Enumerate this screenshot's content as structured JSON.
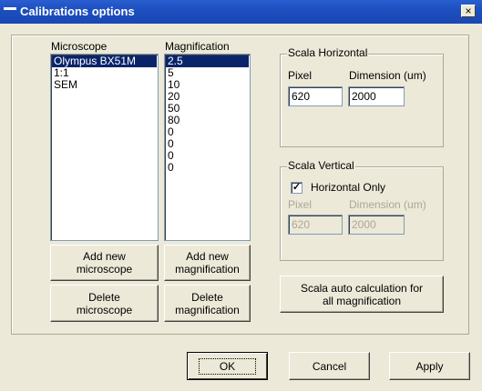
{
  "window": {
    "title": "Calibrations options",
    "close_glyph": "×"
  },
  "microscope": {
    "label": "Microscope",
    "items": [
      {
        "label": "Olympus BX51M",
        "selected": true
      },
      {
        "label": "1:1",
        "selected": false
      },
      {
        "label": "SEM",
        "selected": false
      }
    ],
    "add_button_line1": "Add new",
    "add_button_line2": "microscope",
    "delete_button_line1": "Delete",
    "delete_button_line2": "microscope"
  },
  "magnification": {
    "label": "Magnification",
    "items": [
      {
        "label": "2.5",
        "selected": true
      },
      {
        "label": "5",
        "selected": false
      },
      {
        "label": "10",
        "selected": false
      },
      {
        "label": "20",
        "selected": false
      },
      {
        "label": "50",
        "selected": false
      },
      {
        "label": "80",
        "selected": false
      },
      {
        "label": "0",
        "selected": false
      },
      {
        "label": "0",
        "selected": false
      },
      {
        "label": "0",
        "selected": false
      },
      {
        "label": "0",
        "selected": false
      }
    ],
    "add_button_line1": "Add new",
    "add_button_line2": "magnification",
    "delete_button_line1": "Delete",
    "delete_button_line2": "magnification"
  },
  "scala_horizontal": {
    "title": "Scala Horizontal",
    "pixel_label": "Pixel",
    "dimension_label": "Dimension (um)",
    "pixel_value": "620",
    "dimension_value": "2000"
  },
  "scala_vertical": {
    "title": "Scala Vertical",
    "horizontal_only_label": "Horizontal Only",
    "horizontal_only_checked": true,
    "check_glyph": "✓",
    "pixel_label": "Pixel",
    "dimension_label": "Dimension (um)",
    "pixel_value": "620",
    "dimension_value": "2000"
  },
  "auto_calc_button": {
    "line1": "Scala auto calculation for",
    "line2": "all magnification"
  },
  "footer": {
    "ok_label": "OK",
    "cancel_label": "Cancel",
    "apply_label": "Apply"
  },
  "colors": {
    "titlebar": "#1d4fc0",
    "dialog_bg": "#ece9d8",
    "selection": "#0a246a",
    "field_border": "#7f9db9"
  }
}
